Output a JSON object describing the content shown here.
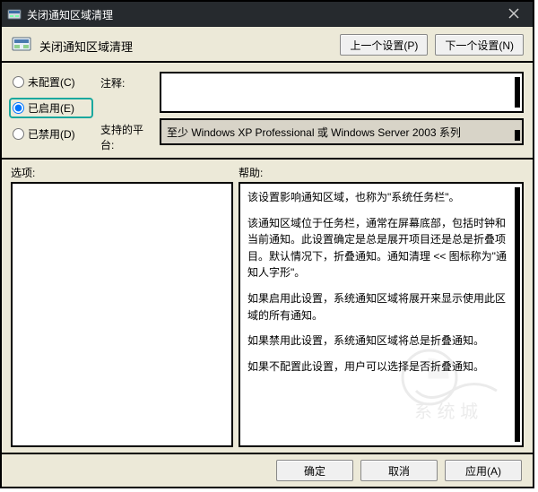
{
  "window": {
    "title": "关闭通知区域清理"
  },
  "header": {
    "title": "关闭通知区域清理",
    "prev_button": "上一个设置(P)",
    "next_button": "下一个设置(N)"
  },
  "radios": {
    "unconfigured": "未配置(C)",
    "enabled": "已启用(E)",
    "disabled": "已禁用(D)",
    "selected": "enabled"
  },
  "labels": {
    "comment": "注释:",
    "platform": "支持的平台:",
    "options": "选项:",
    "help": "帮助:"
  },
  "comment_value": "",
  "platform_value": "至少 Windows XP Professional 或 Windows Server 2003 系列",
  "help_text": {
    "p1": "该设置影响通知区域，也称为\"系统任务栏\"。",
    "p2": "该通知区域位于任务栏，通常在屏幕底部，包括时钟和当前通知。此设置确定是总是展开项目还是总是折叠项目。默认情况下，折叠通知。通知清理 << 图标称为\"通知人字形\"。",
    "p3": "如果启用此设置，系统通知区域将展开来显示使用此区域的所有通知。",
    "p4": "如果禁用此设置，系统通知区域将总是折叠通知。",
    "p5": "如果不配置此设置，用户可以选择是否折叠通知。"
  },
  "footer": {
    "ok": "确定",
    "cancel": "取消",
    "apply": "应用(A)"
  }
}
